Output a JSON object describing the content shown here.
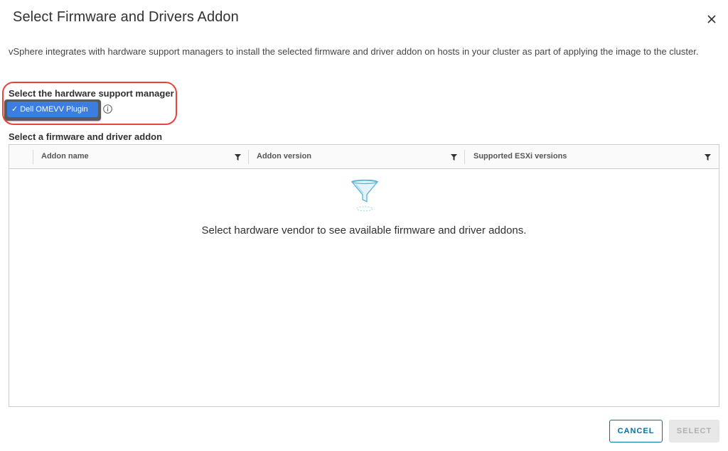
{
  "dialog": {
    "title": "Select Firmware and Drivers Addon",
    "description": "vSphere integrates with hardware support managers to install the selected firmware and driver addon on hosts in your cluster as part of applying the image to the cluster."
  },
  "hardware_support_manager": {
    "label": "Select the hardware support manager",
    "selected_value": "Dell OMEVV Plugin",
    "check_glyph": "✓"
  },
  "addon": {
    "label": "Select a firmware and driver addon",
    "columns": [
      {
        "label": "Addon name"
      },
      {
        "label": "Addon version"
      },
      {
        "label": "Supported ESXi versions"
      }
    ],
    "empty_message": "Select hardware vendor to see available firmware and driver addons."
  },
  "footer": {
    "cancel_label": "CANCEL",
    "select_label": "SELECT"
  },
  "colors": {
    "accent": "#0072a3",
    "chip": "#3b7de0",
    "highlight": "#e8443a",
    "disabled": "#b0b0b0"
  },
  "icons": [
    "close-icon",
    "info-icon",
    "filter-icon",
    "funnel-empty-icon",
    "checkmark-icon"
  ]
}
